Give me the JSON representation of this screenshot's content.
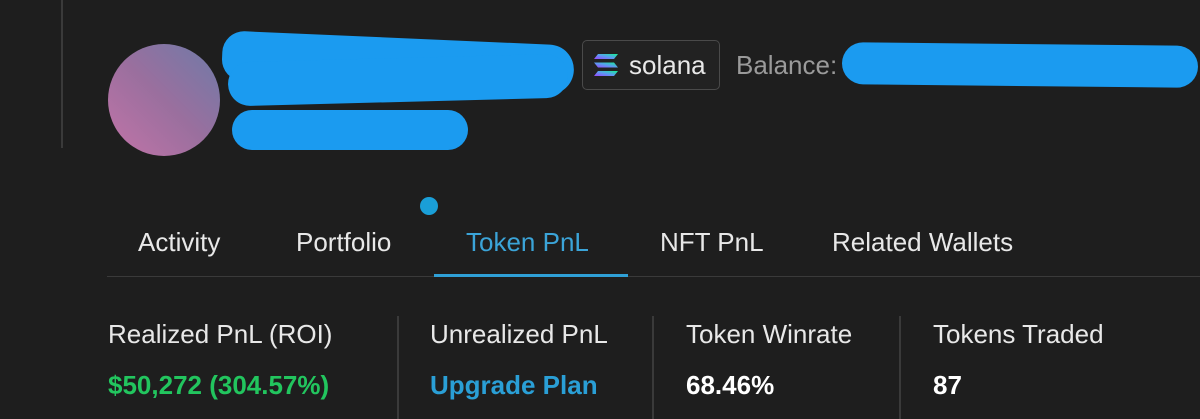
{
  "profile": {
    "chain": {
      "name": "solana",
      "icon": "solana-logo-icon"
    },
    "balance_label": "Balance:"
  },
  "tabs": [
    {
      "label": "Activity",
      "active": false
    },
    {
      "label": "Portfolio",
      "active": false
    },
    {
      "label": "Token PnL",
      "active": true
    },
    {
      "label": "NFT PnL",
      "active": false
    },
    {
      "label": "Related Wallets",
      "active": false
    }
  ],
  "stats": [
    {
      "label": "Realized PnL (ROI)",
      "value": "$50,272 (304.57%)"
    },
    {
      "label": "Unrealized PnL",
      "value": "Upgrade Plan"
    },
    {
      "label": "Token Winrate",
      "value": "68.46%"
    },
    {
      "label": "Tokens Traded",
      "value": "87"
    }
  ],
  "colors": {
    "background": "#1e1e1e",
    "accent": "#3ba4d8",
    "positive": "#22c55e",
    "redaction": "#1b9bf0"
  }
}
